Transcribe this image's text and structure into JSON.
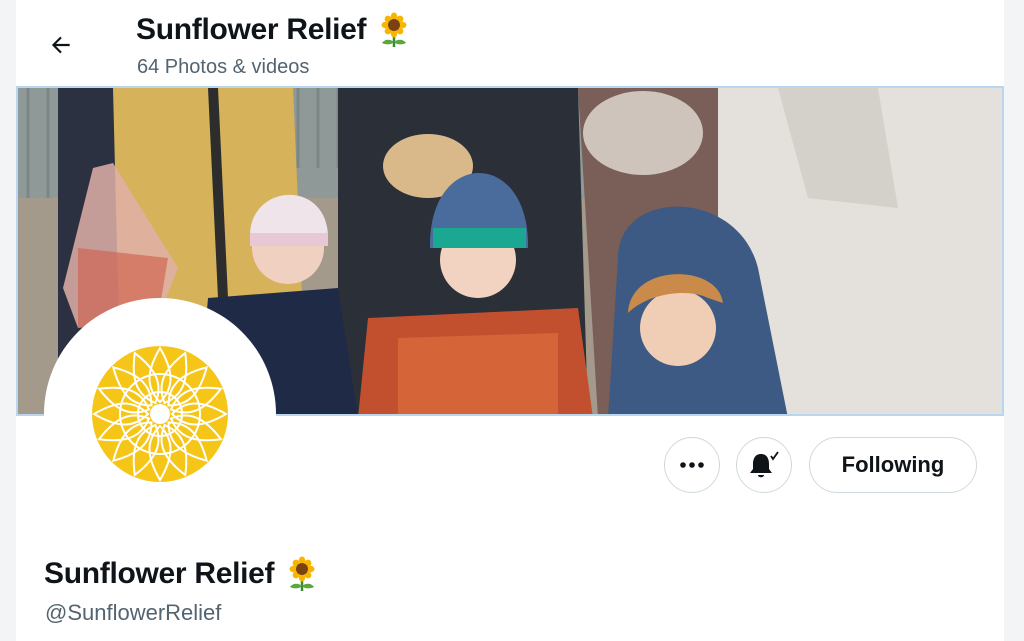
{
  "header": {
    "back_icon": "arrow-left-icon",
    "title": "Sunflower Relief",
    "title_emoji": "sunflower-emoji",
    "subtitle": "64 Photos & videos"
  },
  "banner": {
    "description_icon": "banner-photo"
  },
  "avatar": {
    "logo": "sunflower-logo",
    "color": "#f5c518"
  },
  "actions": {
    "more_icon": "more-icon",
    "notify_icon": "bell-subscribed-icon",
    "follow_label": "Following"
  },
  "profile": {
    "name": "Sunflower Relief",
    "handle": "@SunflowerRelief"
  },
  "colors": {
    "text": "#0f1419",
    "secondary": "#536471",
    "border": "#cfd9de",
    "accent_yellow": "#f5c518"
  }
}
